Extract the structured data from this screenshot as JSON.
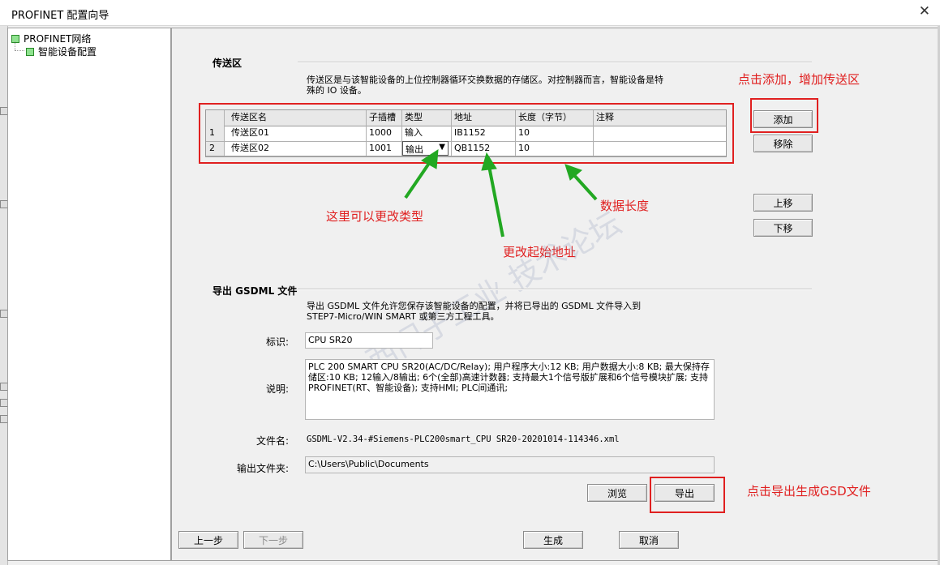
{
  "window": {
    "title": "PROFINET 配置向导",
    "close_glyph": "✕"
  },
  "tree": {
    "root": "PROFINET网络",
    "child": "智能设备配置"
  },
  "transfer": {
    "section_title": "传送区",
    "description_line1": "传送区是与该智能设备的上位控制器循环交换数据的存储区。对控制器而言，智能设备是特",
    "description_line2": "殊的 IO 设备。",
    "columns": [
      "传送区名",
      "子插槽",
      "类型",
      "地址",
      "长度（字节）",
      "注释"
    ],
    "rows": [
      {
        "num": "1",
        "name": "传送区01",
        "slot": "1000",
        "type": "输入",
        "address": "IB1152",
        "length": "10",
        "comment": ""
      },
      {
        "num": "2",
        "name": "传送区02",
        "slot": "1001",
        "type": "输出",
        "address": "QB1152",
        "length": "10",
        "comment": ""
      }
    ],
    "combo_arrow": "▼",
    "buttons": {
      "add": "添加",
      "remove": "移除",
      "up": "上移",
      "down": "下移"
    }
  },
  "export": {
    "section_title": "导出 GSDML 文件",
    "description_line1": "导出 GSDML 文件允许您保存该智能设备的配置，并将已导出的 GSDML 文件导入到",
    "description_line2": "STEP7-Micro/WIN SMART 或第三方工程工具。",
    "id_label": "标识:",
    "id_value": "CPU SR20",
    "desc_label": "说明:",
    "desc_value": "PLC 200 SMART CPU SR20(AC/DC/Relay); 用户程序大小:12 KB; 用户数据大小:8 KB; 最大保持存储区:10 KB; 12输入/8输出; 6个(全部)高速计数器; 支持最大1个信号版扩展和6个信号模块扩展; 支持PROFINET(RT、智能设备); 支持HMI; PLC间通讯;",
    "filename_label": "文件名:",
    "filename_value": "GSDML-V2.34-#Siemens-PLC200smart_CPU SR20-20201014-114346.xml",
    "folder_label": "输出文件夹:",
    "folder_value": "C:\\Users\\Public\\Documents",
    "browse": "浏览",
    "export": "导出"
  },
  "footer": {
    "prev": "上一步",
    "next": "下一步",
    "generate": "生成",
    "cancel": "取消"
  },
  "annotations": {
    "add_note": "点击添加，增加传送区",
    "type_note": "这里可以更改类型",
    "addr_note": "更改起始地址",
    "len_note": "数据长度",
    "export_note": "点击导出生成GSD文件"
  },
  "colors": {
    "annotation_red": "#e02020",
    "arrow_green": "#22a822"
  }
}
